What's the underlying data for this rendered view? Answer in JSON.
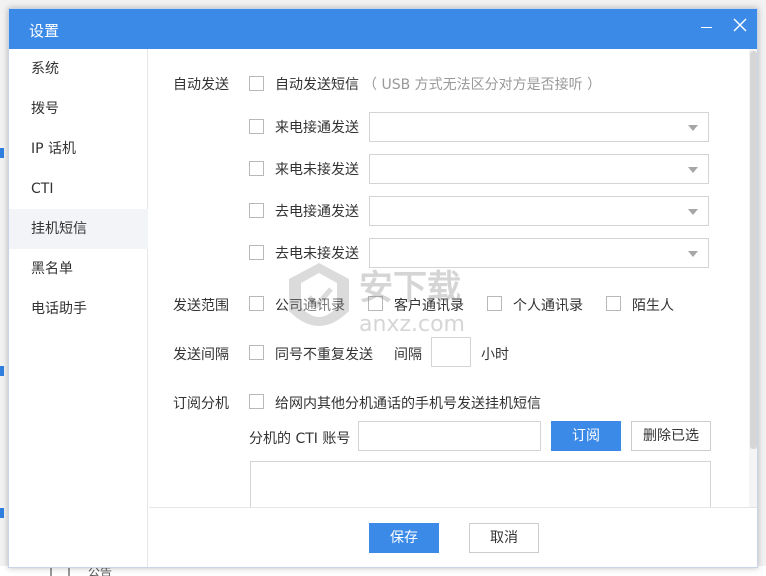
{
  "dialog": {
    "title": "设置",
    "controls": {
      "minimize_icon": "minimize-icon",
      "close_icon": "close-icon"
    }
  },
  "sidebar": {
    "items": [
      {
        "label": "系统"
      },
      {
        "label": "拨号"
      },
      {
        "label": "IP 话机"
      },
      {
        "label": "CTI"
      },
      {
        "label": "挂机短信",
        "active": true
      },
      {
        "label": "黑名单"
      },
      {
        "label": "电话助手"
      }
    ]
  },
  "auto_send": {
    "label": "自动发送",
    "main_option": {
      "text": "自动发送短信",
      "checked": false
    },
    "hint": "（ USB 方式无法区分对方是否接听 ）",
    "options": [
      {
        "text": "来电接通发送",
        "checked": false,
        "selected": ""
      },
      {
        "text": "来电未接发送",
        "checked": false,
        "selected": ""
      },
      {
        "text": "去电接通发送",
        "checked": false,
        "selected": ""
      },
      {
        "text": "去电未接发送",
        "checked": false,
        "selected": ""
      }
    ]
  },
  "send_scope": {
    "label": "发送范围",
    "options": [
      {
        "text": "公司通讯录",
        "checked": false
      },
      {
        "text": "客户通讯录",
        "checked": false
      },
      {
        "text": "个人通讯录",
        "checked": false
      },
      {
        "text": "陌生人",
        "checked": false
      }
    ]
  },
  "send_interval": {
    "label": "发送间隔",
    "option": {
      "text": "同号不重复发送",
      "checked": false
    },
    "interval_label": "间隔",
    "interval_value": "",
    "unit": "小时"
  },
  "subscribe": {
    "label": "订阅分机",
    "option": {
      "text": "给网内其他分机通话的手机号发送挂机短信",
      "checked": false
    },
    "account_label": "分机的 CTI 账号",
    "account_value": "",
    "subscribe_button": "订阅",
    "delete_button": "删除已选"
  },
  "footer": {
    "save_button": "保存",
    "cancel_button": "取消"
  },
  "watermark": {
    "text": "安下载",
    "domain": "anxz.com"
  },
  "background": {
    "partial_text": "公告"
  },
  "colors": {
    "accent": "#3c8ae8",
    "sidebar_active": "#f2f4f8"
  }
}
